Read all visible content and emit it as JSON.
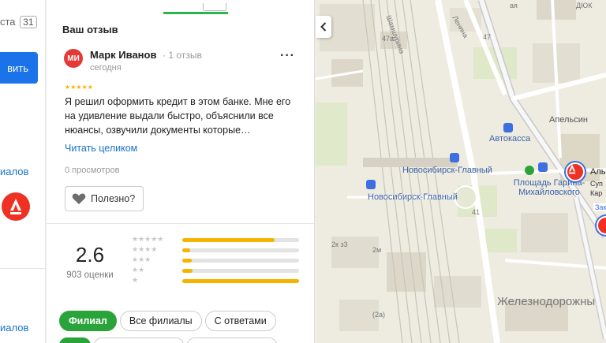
{
  "left_panel": {
    "tab_fragment": "ста",
    "tab_count": "31",
    "button_fragment": "вить",
    "link_fragment_1": "иалов",
    "link_fragment_2": "иалов"
  },
  "review": {
    "section_title": "Ваш отзыв",
    "avatar_initials": "МИ",
    "author_name": "Марк Иванов",
    "author_reviews": "· 1 отзыв",
    "date": "сегодня",
    "more_label": "···",
    "rating_stars": "★★★★★",
    "text": "Я решил оформить кредит в этом банке. Мне его на удивление выдали быстро, объяснили все нюансы, озвучили документы которые…",
    "read_all": "Читать целиком",
    "views": "0 просмотров",
    "useful_label": "Полезно?"
  },
  "rating_summary": {
    "score": "2.6",
    "count_label": "903 оценки",
    "distribution": [
      {
        "stars": "★★★★★",
        "fraction": 0.79
      },
      {
        "stars": "★★★★",
        "fraction": 0.07
      },
      {
        "stars": "★★★",
        "fraction": 0.08
      },
      {
        "stars": "★★",
        "fraction": 0.09
      },
      {
        "stars": "★",
        "fraction": 1.0
      }
    ],
    "accent_color": "#f5b400"
  },
  "filters": [
    {
      "label": "Филиал",
      "active": true
    },
    {
      "label": "Все филиалы",
      "active": false
    },
    {
      "label": "С ответами",
      "active": false
    }
  ],
  "map": {
    "labels": {
      "shamshurina": "Шамшурина",
      "lenina": "Ленина",
      "dyuk": "ДЮК",
      "aya": "ая",
      "n47a": "47а",
      "n47": "47",
      "apelsin": "Апельсин",
      "avtokassa": "Автокасса",
      "station1": "Новосибирск-Главный",
      "station2": "Новосибирск-Главный",
      "square": "Площадь Гарина-Михайловского",
      "n41": "41",
      "n2kz3": "2к з3",
      "n2m": "2м",
      "n2a": "(2а)",
      "zhd": "Железнодорожны",
      "alfa_fragment": "Аль",
      "sup_fragment": "Суп",
      "kar_fragment": "Кар",
      "zak_fragment": "Зак"
    }
  }
}
